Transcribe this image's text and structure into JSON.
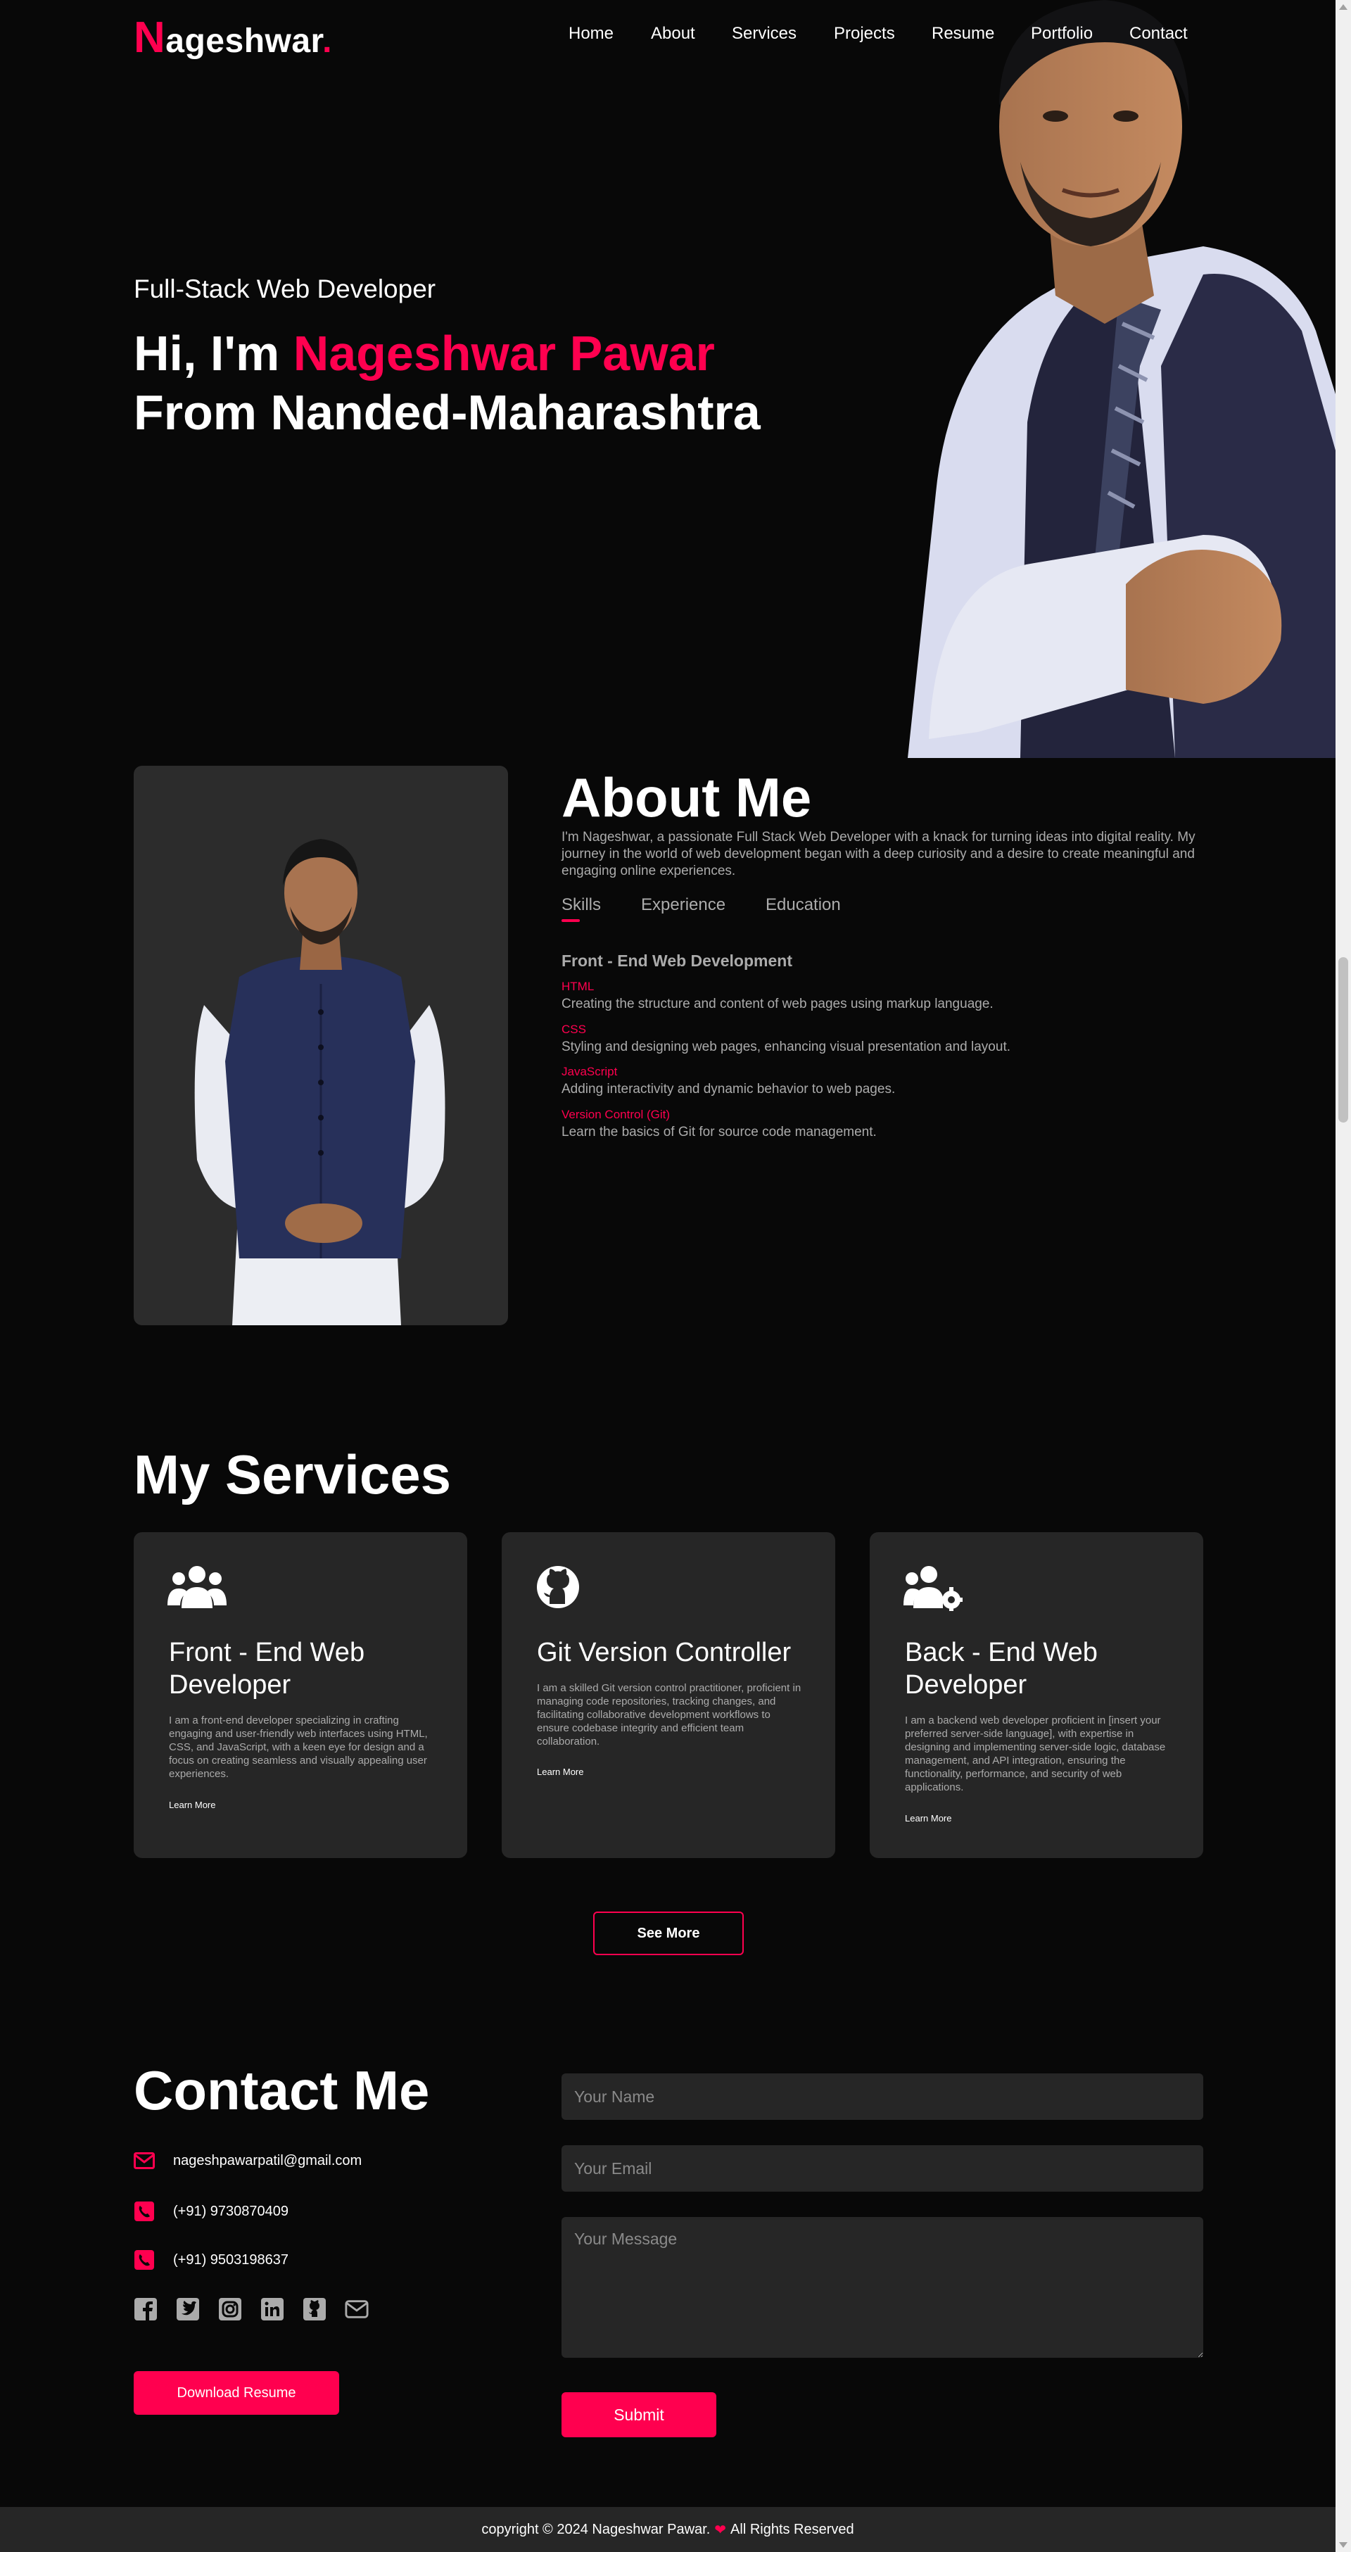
{
  "brand": {
    "initial": "N",
    "rest": "ageshwar",
    "dot": "."
  },
  "nav": [
    "Home",
    "About",
    "Services",
    "Projects",
    "Resume",
    "Portfolio",
    "Contact"
  ],
  "hero": {
    "subtitle": "Full-Stack Web Developer",
    "greeting": "Hi, I'm ",
    "name": "Nageshwar Pawar",
    "line2": "From Nanded-Maharashtra"
  },
  "about": {
    "title": "About Me",
    "text": "I'm Nageshwar, a passionate Full Stack Web Developer with a knack for turning ideas into digital reality. My journey in the world of web development began with a deep curiosity and a desire to create meaningful and engaging online experiences.",
    "tabs": [
      "Skills",
      "Experience",
      "Education"
    ],
    "active_tab": "Skills",
    "skills_heading": "Front - End Web Development",
    "skills": [
      {
        "name": "HTML",
        "desc": "Creating the structure and content of web pages using markup language."
      },
      {
        "name": "CSS",
        "desc": "Styling and designing web pages, enhancing visual presentation and layout."
      },
      {
        "name": "JavaScript",
        "desc": "Adding interactivity and dynamic behavior to web pages."
      },
      {
        "name": "Version Control (Git)",
        "desc": "Learn the basics of Git for source code management."
      }
    ]
  },
  "services": {
    "title": "My Services",
    "cards": [
      {
        "icon": "users-icon",
        "title": "Front - End Web Developer",
        "desc": "I am a front-end developer specializing in crafting engaging and user-friendly web interfaces using HTML, CSS, and JavaScript, with a keen eye for design and a focus on creating seamless and visually appealing user experiences.",
        "link": "Learn More"
      },
      {
        "icon": "github-icon",
        "title": "Git Version Controller",
        "desc": "I am a skilled Git version control practitioner, proficient in managing code repositories, tracking changes, and facilitating collaborative development workflows to ensure codebase integrity and efficient team collaboration.",
        "link": "Learn More"
      },
      {
        "icon": "users-gear-icon",
        "title": "Back - End Web Developer",
        "desc": "I am a backend web developer proficient in [insert your preferred server-side language], with expertise in designing and implementing server-side logic, database management, and API integration, ensuring the functionality, performance, and security of web applications.",
        "link": "Learn More"
      }
    ],
    "see_more": "See More"
  },
  "contact": {
    "title": "Contact Me",
    "email": "nageshpawarpatil@gmail.com",
    "phone1": "(+91) 9730870409",
    "phone2": "(+91) 9503198637",
    "socials": [
      "facebook-icon",
      "twitter-icon",
      "instagram-icon",
      "linkedin-icon",
      "github-icon",
      "envelope-icon"
    ],
    "download": "Download Resume",
    "form": {
      "name_placeholder": "Your Name",
      "email_placeholder": "Your Email",
      "message_placeholder": "Your Message",
      "submit": "Submit"
    }
  },
  "footer": {
    "prefix": "copyright © 2024 Nageshwar Pawar.",
    "suffix": "All Rights Reserved"
  },
  "colors": {
    "accent": "#ff004f",
    "bg": "#080808",
    "card": "#262626",
    "muted": "#ababab"
  }
}
